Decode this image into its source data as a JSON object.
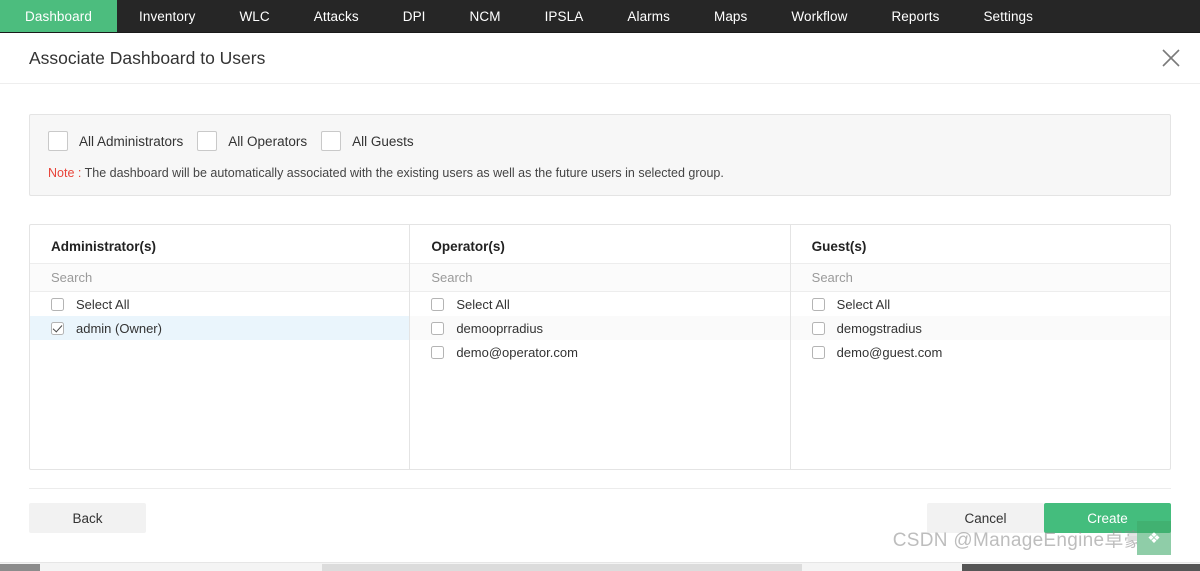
{
  "topnav": {
    "items": [
      {
        "label": "Dashboard",
        "active": true
      },
      {
        "label": "Inventory",
        "active": false
      },
      {
        "label": "WLC",
        "active": false
      },
      {
        "label": "Attacks",
        "active": false
      },
      {
        "label": "DPI",
        "active": false
      },
      {
        "label": "NCM",
        "active": false
      },
      {
        "label": "IPSLA",
        "active": false
      },
      {
        "label": "Alarms",
        "active": false
      },
      {
        "label": "Maps",
        "active": false
      },
      {
        "label": "Workflow",
        "active": false
      },
      {
        "label": "Reports",
        "active": false
      },
      {
        "label": "Settings",
        "active": false
      }
    ],
    "active_bg": "#4CBD7E",
    "bg": "#262626"
  },
  "dialog": {
    "title": "Associate Dashboard to Users",
    "close_icon": "close-icon"
  },
  "group_section": {
    "checkboxes": [
      {
        "label": "All Administrators",
        "checked": false
      },
      {
        "label": "All Operators",
        "checked": false
      },
      {
        "label": "All Guests",
        "checked": false
      }
    ],
    "note_label": "Note :",
    "note_color": "#e8443a",
    "note_text": " The dashboard will be automatically associated with the existing users as well as the future users in selected group."
  },
  "columns": [
    {
      "title": "Administrator(s)",
      "search_placeholder": "Search",
      "search_value": "",
      "options": [
        {
          "label": "Select All",
          "checked": false,
          "selected": false,
          "alt": false
        },
        {
          "label": "admin (Owner)",
          "checked": true,
          "selected": true,
          "alt": false
        }
      ]
    },
    {
      "title": "Operator(s)",
      "search_placeholder": "Search",
      "search_value": "",
      "options": [
        {
          "label": "Select All",
          "checked": false,
          "selected": false,
          "alt": false
        },
        {
          "label": "demooprradius",
          "checked": false,
          "selected": false,
          "alt": true
        },
        {
          "label": "demo@operator.com",
          "checked": false,
          "selected": false,
          "alt": false
        }
      ]
    },
    {
      "title": "Guest(s)",
      "search_placeholder": "Search",
      "search_value": "",
      "options": [
        {
          "label": "Select All",
          "checked": false,
          "selected": false,
          "alt": false
        },
        {
          "label": "demogstradius",
          "checked": false,
          "selected": false,
          "alt": true
        },
        {
          "label": "demo@guest.com",
          "checked": false,
          "selected": false,
          "alt": false
        }
      ]
    }
  ],
  "footer": {
    "back_label": "Back",
    "cancel_label": "Cancel",
    "create_label": "Create",
    "create_color": "#44bd7d"
  },
  "watermark": {
    "text": "CSDN @ManageEngine卓豪"
  }
}
